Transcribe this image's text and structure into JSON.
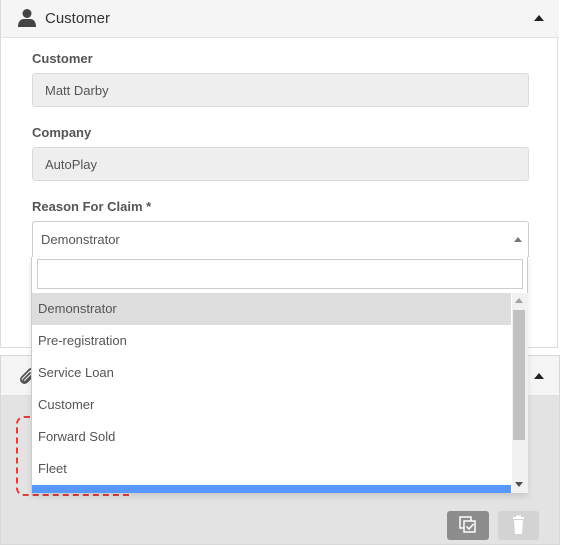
{
  "customer_panel": {
    "title": "Customer",
    "icon": "user-icon",
    "fields": {
      "customer": {
        "label": "Customer",
        "value": "Matt Darby"
      },
      "company": {
        "label": "Company",
        "value": "AutoPlay"
      },
      "reason": {
        "label": "Reason For Claim *",
        "selected": "Demonstrator"
      }
    }
  },
  "reason_dropdown": {
    "search_value": "",
    "options": [
      "Demonstrator",
      "Pre-registration",
      "Service Loan",
      "Customer",
      "Forward Sold",
      "Fleet"
    ],
    "selected_option": "Demonstrator"
  },
  "attachments_panel": {
    "icon": "paperclip-icon",
    "buttons": {
      "copy": "copy-check-icon",
      "delete": "trash-icon"
    }
  },
  "colors": {
    "highlight": "#5897fb",
    "selected_bg": "#dddddd",
    "dashed_border": "#d94040"
  }
}
